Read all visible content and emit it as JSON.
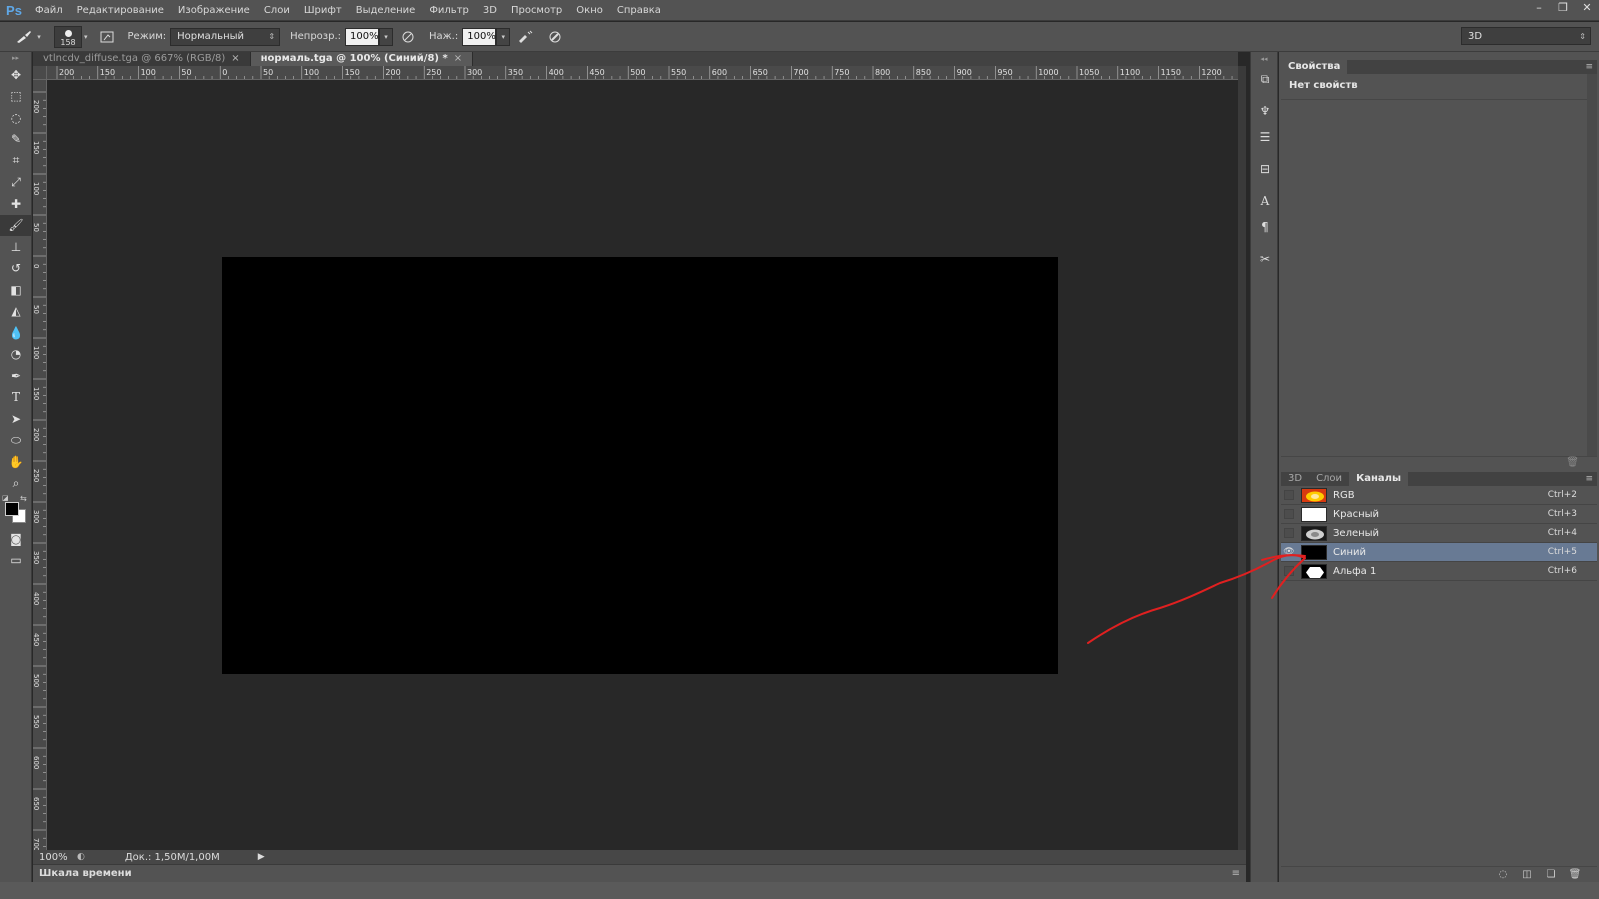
{
  "app": {
    "logo": "Ps"
  },
  "menu": [
    "Файл",
    "Редактирование",
    "Изображение",
    "Слои",
    "Шрифт",
    "Выделение",
    "Фильтр",
    "3D",
    "Просмотр",
    "Окно",
    "Справка"
  ],
  "window_controls": {
    "minimize": "–",
    "restore": "❐",
    "close": "✕"
  },
  "options": {
    "brush_size": "158",
    "mode_label": "Режим:",
    "mode_value": "Нормальный",
    "opacity_label": "Непрозр.:",
    "opacity_value": "100%",
    "flow_label": "Наж.:",
    "flow_value": "100%",
    "workspace": "3D"
  },
  "tabs": [
    {
      "label": "vtlncdv_diffuse.tga @ 667% (RGB/8)",
      "close": "×"
    },
    {
      "label": "нормаль.tga @ 100% (Синий/8) *",
      "close": "×"
    }
  ],
  "ruler_top_labels": [
    "200",
    "150",
    "100",
    "50",
    "0",
    "50",
    "100",
    "150",
    "200",
    "250",
    "300",
    "350",
    "400",
    "450",
    "500",
    "550",
    "600",
    "650",
    "700",
    "750",
    "800",
    "850",
    "900",
    "950",
    "1000",
    "1050",
    "1100",
    "1150",
    "1200"
  ],
  "ruler_left_labels": [
    "200",
    "150",
    "100",
    "50",
    "0",
    "50",
    "100",
    "150",
    "200",
    "250",
    "300",
    "350",
    "400",
    "450",
    "500",
    "550",
    "600",
    "650",
    "700"
  ],
  "status": {
    "zoom": "100%",
    "doc": "Док.: 1,50M/1,00M",
    "play": "▶"
  },
  "timeline": {
    "label": "Шкала времени",
    "menu": "≡"
  },
  "properties": {
    "tab": "Свойства",
    "menu": "≡",
    "content": "Нет свойств",
    "trash": "🗑"
  },
  "channels_panel": {
    "tabs": [
      "3D",
      "Слои",
      "Каналы"
    ],
    "active_tab": 2,
    "menu": "≡",
    "rows": [
      {
        "name": "RGB",
        "shortcut": "Ctrl+2",
        "thumb": "rgb",
        "visible": false,
        "selected": false
      },
      {
        "name": "Красный",
        "shortcut": "Ctrl+3",
        "thumb": "white",
        "visible": false,
        "selected": false
      },
      {
        "name": "Зеленый",
        "shortcut": "Ctrl+4",
        "thumb": "green",
        "visible": false,
        "selected": false
      },
      {
        "name": "Синий",
        "shortcut": "Ctrl+5",
        "thumb": "black",
        "visible": true,
        "selected": true
      },
      {
        "name": "Альфа 1",
        "shortcut": "Ctrl+6",
        "thumb": "alpha",
        "visible": false,
        "selected": false
      }
    ],
    "footer_icons": [
      "◌",
      "◫",
      "❏",
      "🗑"
    ]
  },
  "colors": {
    "ui_bg": "#535353",
    "workspace_bg": "#282828",
    "canvas": "#000000",
    "selection": "#687a94",
    "annotation": "#e02020"
  }
}
